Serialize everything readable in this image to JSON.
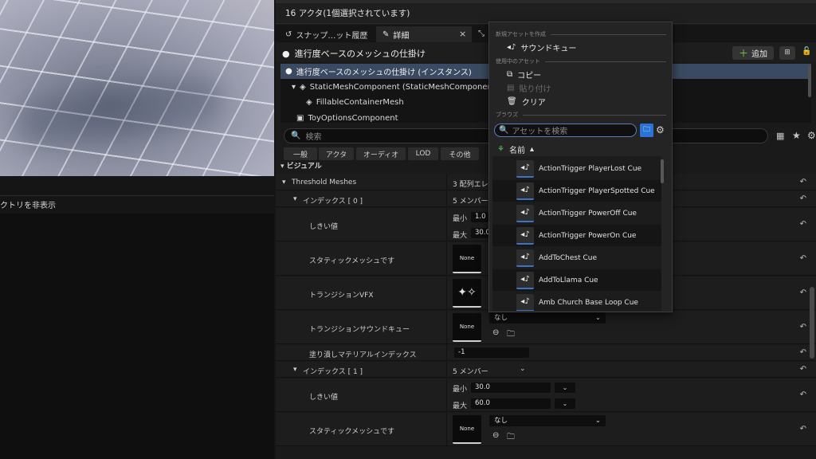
{
  "window": {
    "actor_count": "16 アクタ(1個選択されています)"
  },
  "left": {
    "hide_dir": "クトリを非表示"
  },
  "tabs": [
    {
      "label": "スナップ…ット履歴",
      "icon": "history-icon"
    },
    {
      "label": "詳細",
      "icon": "pencil-icon"
    }
  ],
  "header": {
    "title": "進行度ベースのメッシュの仕掛け",
    "add_label": "追加"
  },
  "tree": {
    "instance": "進行度ベースのメッシュの仕掛け (インスタンス)",
    "smc": "StaticMeshComponent (StaticMeshComponent0)",
    "fill": "FillableContainerMesh",
    "toy": "ToyOptionsComponent"
  },
  "search": {
    "placeholder": "検索"
  },
  "filters": [
    "一般",
    "アクタ",
    "オーディオ",
    "LOD",
    "その他"
  ],
  "section": {
    "visual": "ビジュアル"
  },
  "props": {
    "threshold_meshes": "Threshold Meshes",
    "array_count": "3 配列エレメント",
    "index0": "インデックス [ 0 ]",
    "index1": "インデックス [ 1 ]",
    "members": "5 メンバー",
    "threshold": "しきい値",
    "min_label": "最小",
    "max_label": "最大",
    "idx0_min": "1.0",
    "idx0_max": "30.0",
    "idx1_min": "30.0",
    "idx1_max": "60.0",
    "static_mesh": "スタティックメッシュです",
    "none": "None",
    "transition_vfx": "トランジションVFX",
    "transition_sound": "トランジションサウンドキュー",
    "fill_material": "塗り潰しマテリアルインデックス",
    "fill_index": "-1",
    "nashi": "なし"
  },
  "popup": {
    "section_create": "新規アセットを作成",
    "sound_cue": "サウンドキュー",
    "section_current": "使用中のアセット",
    "copy": "コピー",
    "paste": "貼り付け",
    "clear": "クリア",
    "section_browse": "ブラウズ",
    "search_placeholder": "アセットを検索",
    "col_name": "名前",
    "assets": [
      "ActionTrigger PlayerLost Cue",
      "ActionTrigger PlayerSpotted Cue",
      "ActionTrigger PowerOff Cue",
      "ActionTrigger PowerOn Cue",
      "AddToChest Cue",
      "AddToLlama Cue",
      "Amb Church Base Loop Cue"
    ]
  }
}
